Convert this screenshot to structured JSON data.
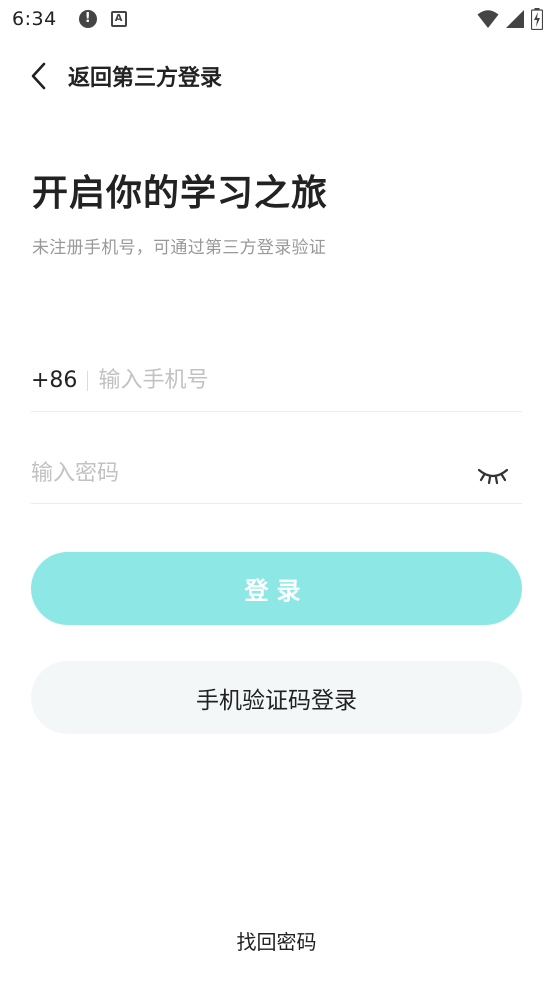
{
  "status_bar": {
    "time": "6:34",
    "alert_glyph": "!",
    "a_glyph": "A"
  },
  "header": {
    "back_label": "返回第三方登录"
  },
  "title": "开启你的学习之旅",
  "subtitle": "未注册手机号，可通过第三方登录验证",
  "phone": {
    "country_code": "+86",
    "placeholder": "输入手机号",
    "value": ""
  },
  "password": {
    "placeholder": "输入密码",
    "value": ""
  },
  "buttons": {
    "login": "登录",
    "sms_login": "手机验证码登录"
  },
  "links": {
    "forgot_password": "找回密码"
  },
  "colors": {
    "accent": "#8de8e5",
    "secondary_button_bg": "#f4f7f8"
  }
}
